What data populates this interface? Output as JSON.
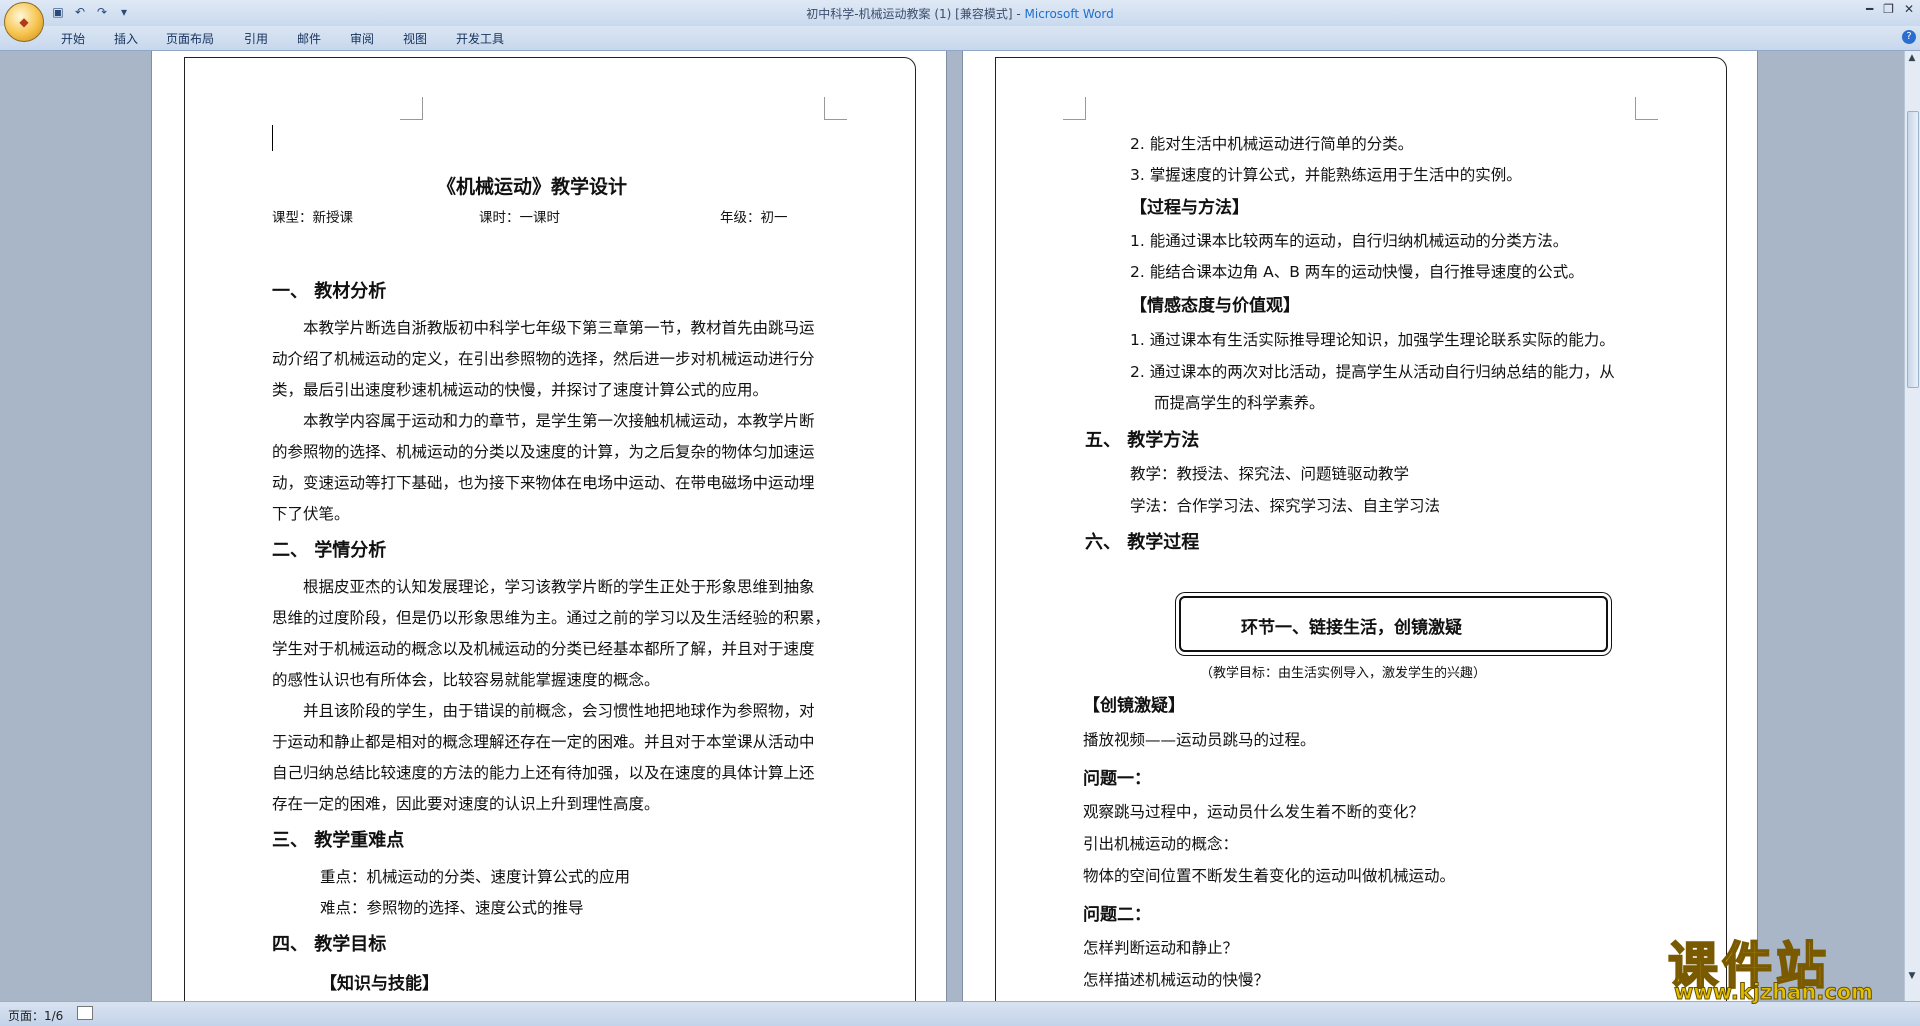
{
  "window": {
    "title_doc": "初中科学-机械运动教案 (1) [兼容模式] - ",
    "title_app": "Microsoft Word"
  },
  "ribbon": {
    "tabs": [
      "开始",
      "插入",
      "页面布局",
      "引用",
      "邮件",
      "审阅",
      "视图",
      "开发工具"
    ]
  },
  "page1": {
    "title": "《机械运动》教学设计",
    "meta_type": "课型：新授课",
    "meta_hours": "课时：一课时",
    "meta_grade": "年级：初一",
    "s1_heading": "一、  教材分析",
    "s1_p1": [
      "本教学片断选自浙教版初中科学七年级下第三章第一节，教材首先由跳马运",
      "动介绍了机械运动的定义，在引出参照物的选择，然后进一步对机械运动进行分",
      "类，最后引出速度秒速机械运动的快慢，并探讨了速度计算公式的应用。"
    ],
    "s1_p2": [
      "本教学内容属于运动和力的章节，是学生第一次接触机械运动，本教学片断",
      "的参照物的选择、机械运动的分类以及速度的计算，为之后复杂的物体匀加速运",
      "动，变速运动等打下基础，也为接下来物体在电场中运动、在带电磁场中运动埋",
      "下了伏笔。"
    ],
    "s2_heading": "二、  学情分析",
    "s2_p1": [
      "根据皮亚杰的认知发展理论，学习该教学片断的学生正处于形象思维到抽象",
      "思维的过度阶段，但是仍以形象思维为主。通过之前的学习以及生活经验的积累，",
      "学生对于机械运动的概念以及机械运动的分类已经基本都所了解，并且对于速度",
      "的感性认识也有所体会，比较容易就能掌握速度的概念。"
    ],
    "s2_p2": [
      "并且该阶段的学生，由于错误的前概念，会习惯性地把地球作为参照物，对",
      "于运动和静止都是相对的概念理解还存在一定的困难。并且对于本堂课从活动中",
      "自己归纳总结比较速度的方法的能力上还有待加强，以及在速度的具体计算上还",
      "存在一定的困难，因此要对速度的认识上升到理性高度。"
    ],
    "s3_heading": "三、  教学重难点",
    "s3_key": "重点：机械运动的分类、速度计算公式的应用",
    "s3_diff": "难点：参照物的选择、速度公式的推导",
    "s4_heading": "四、  教学目标",
    "s4_sub": "【知识与技能】"
  },
  "page2": {
    "k_items": [
      "2.  能对生活中机械运动进行简单的分类。",
      "3.  掌握速度的计算公式，并能熟练运用于生活中的实例。"
    ],
    "process_heading": "【过程与方法】",
    "process_items": [
      "1.  能通过课本比较两车的运动，自行归纳机械运动的分类方法。",
      "2.  能结合课本边角 A、B 两车的运动快慢，自行推导速度的公式。"
    ],
    "emotion_heading": "【情感态度与价值观】",
    "emotion_items": [
      "1.  通过课本有生活实际推导理论知识，加强学生理论联系实际的能力。",
      "2.  通过课本的两次对比活动，提高学生从活动自行归纳总结的能力，从",
      "而提高学生的科学素养。"
    ],
    "s5_heading": "五、  教学方法",
    "s5_teach": "教学：教授法、探究法、问题链驱动教学",
    "s5_learn": "学法：合作学习法、探究学习法、自主学习法",
    "s6_heading": "六、  教学过程",
    "stage_title": "环节一、链接生活，创镜激疑",
    "stage_goal": "（教学目标：由生活实例导入，激发学生的兴趣）",
    "create_heading": "【创镜激疑】",
    "video_line": "播放视频——运动员跳马的过程。",
    "q1_heading": "问题一：",
    "q1_lines": [
      "观察跳马过程中，运动员什么发生着不断的变化？",
      "引出机械运动的概念：",
      "物体的空间位置不断发生着变化的运动叫做机械运动。"
    ],
    "q2_heading": "问题二：",
    "q2_lines": [
      "怎样判断运动和静止？",
      "怎样描述机械运动的快慢？"
    ]
  },
  "status": {
    "page_indicator": "页面：1/6"
  },
  "watermark": {
    "brand": "课件站",
    "url": "www.kjzhan.com"
  }
}
